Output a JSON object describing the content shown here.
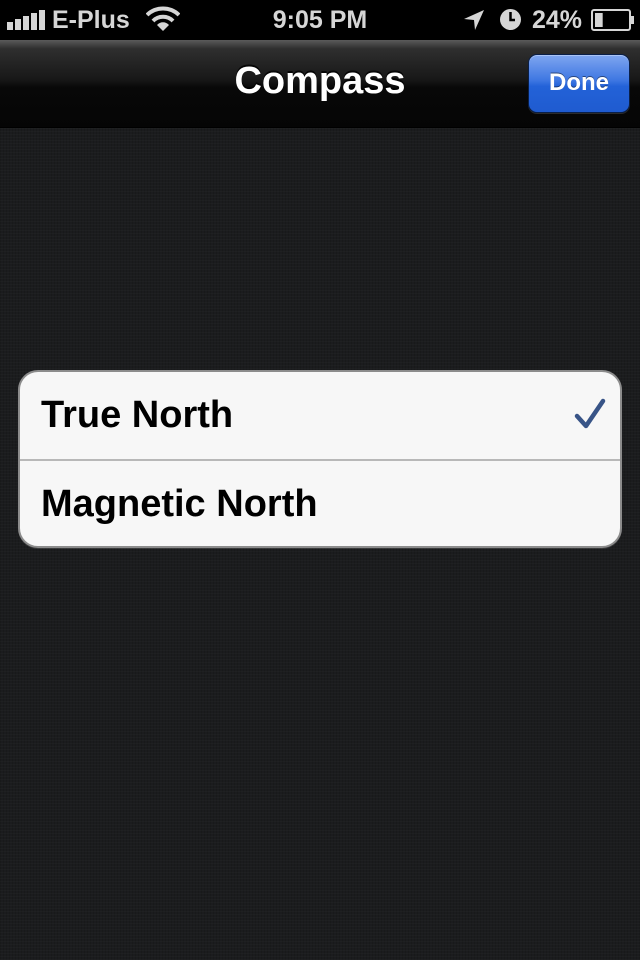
{
  "status_bar": {
    "carrier": "E-Plus",
    "time": "9:05 PM",
    "battery_percent": "24%",
    "battery_level": 0.24,
    "signal_icon": "signal-bars-icon",
    "wifi_icon": "wifi-icon",
    "location_icon": "location-arrow-icon",
    "alarm_icon": "alarm-clock-icon",
    "text_color": "#d6d6d6"
  },
  "nav_bar": {
    "title": "Compass",
    "done_label": "Done",
    "done_color": "#2362d8"
  },
  "options": {
    "items": [
      {
        "label": "True North",
        "selected": true
      },
      {
        "label": "Magnetic North",
        "selected": false
      }
    ],
    "checkmark_icon": "checkmark-icon",
    "checkmark_color": "#385487"
  }
}
